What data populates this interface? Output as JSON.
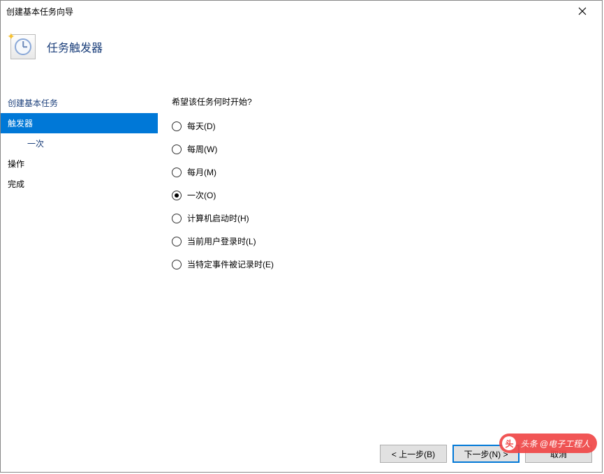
{
  "window": {
    "title": "创建基本任务向导"
  },
  "header": {
    "title": "任务触发器"
  },
  "nav": {
    "items": [
      {
        "label": "创建基本任务",
        "link": true,
        "selected": false,
        "sub": false
      },
      {
        "label": "触发器",
        "link": false,
        "selected": true,
        "sub": false
      },
      {
        "label": "一次",
        "link": true,
        "selected": false,
        "sub": true
      },
      {
        "label": "操作",
        "link": false,
        "selected": false,
        "sub": false
      },
      {
        "label": "完成",
        "link": false,
        "selected": false,
        "sub": false
      }
    ]
  },
  "content": {
    "prompt": "希望该任务何时开始?",
    "options": [
      {
        "label": "每天(D)",
        "checked": false
      },
      {
        "label": "每周(W)",
        "checked": false
      },
      {
        "label": "每月(M)",
        "checked": false
      },
      {
        "label": "一次(O)",
        "checked": true
      },
      {
        "label": "计算机启动时(H)",
        "checked": false
      },
      {
        "label": "当前用户登录时(L)",
        "checked": false
      },
      {
        "label": "当特定事件被记录时(E)",
        "checked": false
      }
    ]
  },
  "footer": {
    "back": "< 上一步(B)",
    "next": "下一步(N) >",
    "cancel": "取消"
  },
  "watermark": {
    "icon": "头",
    "text": "头条 @电子工程人"
  }
}
